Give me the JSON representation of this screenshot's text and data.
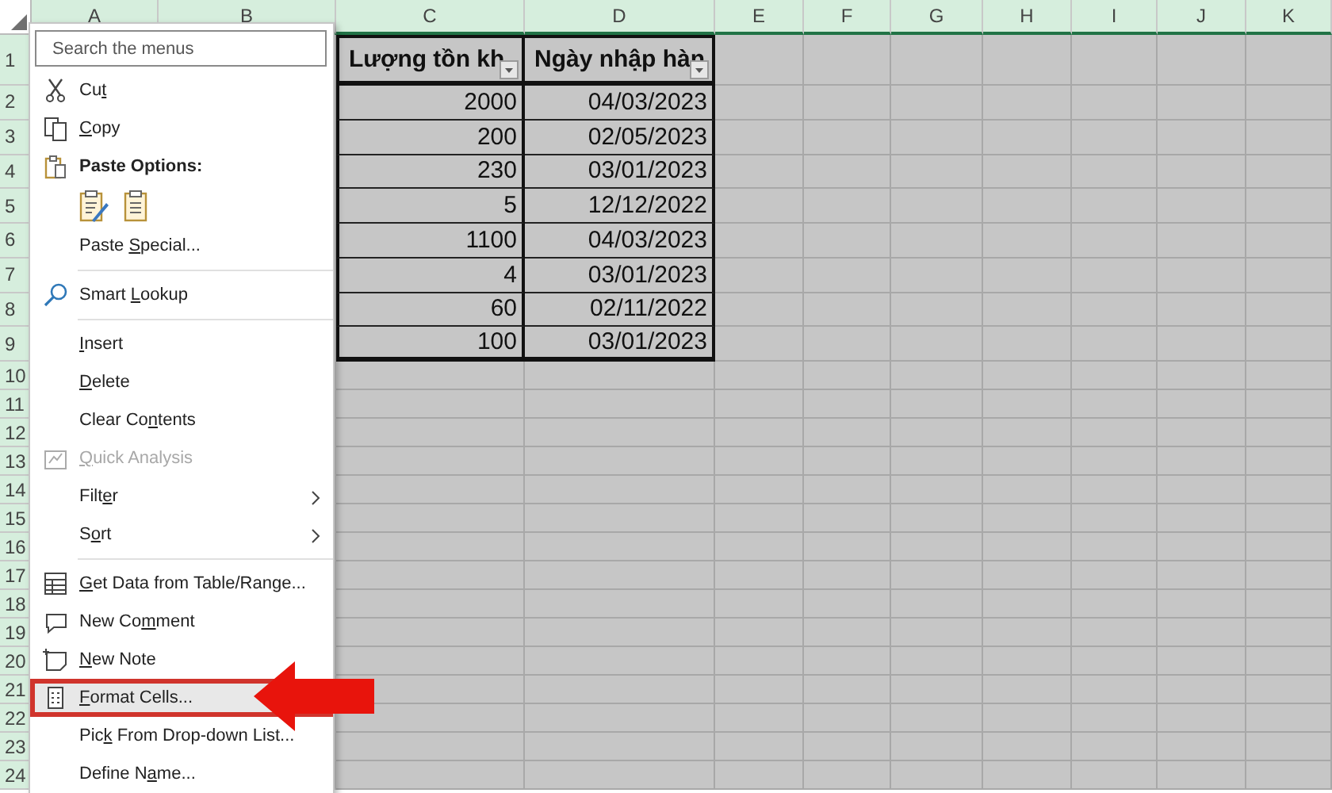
{
  "sheet": {
    "all_selected": true,
    "columns": [
      "A",
      "B",
      "C",
      "D",
      "E",
      "F",
      "G",
      "H",
      "I",
      "J",
      "K"
    ],
    "rows": [
      "1",
      "2",
      "3",
      "4",
      "5",
      "6",
      "7",
      "8",
      "9",
      "10",
      "11",
      "12",
      "13",
      "14",
      "15",
      "16",
      "17",
      "18",
      "19",
      "20",
      "21",
      "22",
      "23",
      "24"
    ],
    "table": {
      "headers": [
        "Lượng tồn kh",
        "Ngày nhập hàn"
      ],
      "rows": [
        [
          "2000",
          "04/03/2023"
        ],
        [
          "200",
          "02/05/2023"
        ],
        [
          "230",
          "03/01/2023"
        ],
        [
          "5",
          "12/12/2022"
        ],
        [
          "1100",
          "04/03/2023"
        ],
        [
          "4",
          "03/01/2023"
        ],
        [
          "60",
          "02/11/2022"
        ],
        [
          "100",
          "03/01/2023"
        ]
      ]
    }
  },
  "context_menu": {
    "search": {
      "placeholder": "Search the menus"
    },
    "items": [
      {
        "kind": "item",
        "label": {
          "pre": "Cu",
          "key": "t"
        },
        "disabled": false,
        "submenu": false,
        "highlighted": false,
        "annotated": false
      },
      {
        "kind": "item",
        "label": {
          "key": "C",
          "post": "opy"
        },
        "disabled": false,
        "submenu": false,
        "highlighted": false,
        "annotated": false
      },
      {
        "kind": "heading",
        "label": {
          "pre": "Paste Options:"
        }
      },
      {
        "kind": "paste-icons"
      },
      {
        "kind": "item",
        "label": {
          "pre": "Paste ",
          "key": "S",
          "post": "pecial..."
        },
        "disabled": false,
        "submenu": false,
        "highlighted": false,
        "annotated": false
      },
      {
        "kind": "separator"
      },
      {
        "kind": "item",
        "label": {
          "pre": "Smart ",
          "key": "L",
          "post": "ookup"
        },
        "disabled": false,
        "submenu": false,
        "highlighted": false,
        "annotated": false
      },
      {
        "kind": "separator"
      },
      {
        "kind": "item",
        "label": {
          "key": "I",
          "post": "nsert"
        },
        "disabled": false,
        "submenu": false,
        "highlighted": false,
        "annotated": false
      },
      {
        "kind": "item",
        "label": {
          "key": "D",
          "post": "elete"
        },
        "disabled": false,
        "submenu": false,
        "highlighted": false,
        "annotated": false
      },
      {
        "kind": "item",
        "label": {
          "pre": "Clear Co",
          "key": "n",
          "post": "tents"
        },
        "disabled": false,
        "submenu": false,
        "highlighted": false,
        "annotated": false
      },
      {
        "kind": "item",
        "label": {
          "key": "Q",
          "post": "uick Analysis"
        },
        "disabled": true,
        "submenu": false,
        "highlighted": false,
        "annotated": false
      },
      {
        "kind": "item",
        "label": {
          "pre": "Filt",
          "key": "e",
          "post": "r"
        },
        "disabled": false,
        "submenu": true,
        "highlighted": false,
        "annotated": false
      },
      {
        "kind": "item",
        "label": {
          "pre": "S",
          "key": "o",
          "post": "rt"
        },
        "disabled": false,
        "submenu": true,
        "highlighted": false,
        "annotated": false
      },
      {
        "kind": "separator"
      },
      {
        "kind": "item",
        "label": {
          "key": "G",
          "post": "et Data from Table/Range..."
        },
        "disabled": false,
        "submenu": false,
        "highlighted": false,
        "annotated": false
      },
      {
        "kind": "item",
        "label": {
          "pre": "New Co",
          "key": "m",
          "post": "ment"
        },
        "disabled": false,
        "submenu": false,
        "highlighted": false,
        "annotated": false
      },
      {
        "kind": "item",
        "label": {
          "key": "N",
          "post": "ew Note"
        },
        "disabled": false,
        "submenu": false,
        "highlighted": false,
        "annotated": false
      },
      {
        "kind": "item",
        "label": {
          "key": "F",
          "post": "ormat Cells..."
        },
        "disabled": false,
        "submenu": false,
        "highlighted": true,
        "annotated": true
      },
      {
        "kind": "item",
        "label": {
          "pre": "Pic",
          "key": "k",
          "post": " From Drop-down List..."
        },
        "disabled": false,
        "submenu": false,
        "highlighted": false,
        "annotated": false
      },
      {
        "kind": "item",
        "label": {
          "pre": "Define N",
          "key": "a",
          "post": "me..."
        },
        "disabled": false,
        "submenu": false,
        "highlighted": false,
        "annotated": false
      }
    ]
  }
}
